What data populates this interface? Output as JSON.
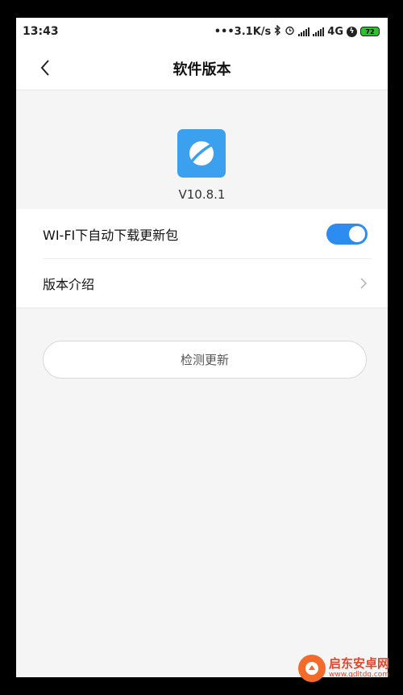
{
  "status_bar": {
    "time": "13:43",
    "speed": "•••3.1K/s",
    "network": "4G",
    "battery": "72"
  },
  "header": {
    "title": "软件版本"
  },
  "app": {
    "version": "V10.8.1",
    "icon_color": "#3ba0ee"
  },
  "settings": {
    "wifi_auto_download": {
      "label": "WI-FI下自动下载更新包",
      "enabled": true
    },
    "version_intro": {
      "label": "版本介绍"
    }
  },
  "actions": {
    "check_update_label": "检测更新"
  },
  "watermark": {
    "title": "启东安卓网",
    "url": "www.qdltdq.com"
  },
  "colors": {
    "accent": "#2d8cf0",
    "background": "#f5f5f5"
  }
}
